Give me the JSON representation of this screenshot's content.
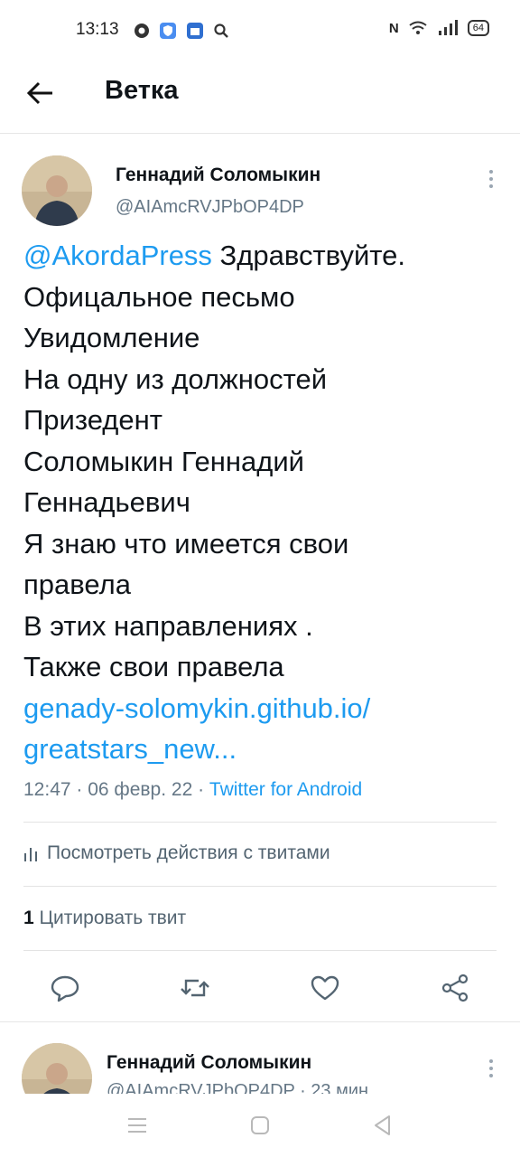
{
  "status_bar": {
    "time": "13:13",
    "battery": "64"
  },
  "header": {
    "title": "Ветка"
  },
  "tweet": {
    "author_name": "Геннадий Соломыкин",
    "author_handle": "@AIAmcRVJPbOP4DP",
    "mention": "@AkordaPress",
    "text_first": " Здравствуйте.",
    "text_lines": "Офицальное песьмо\nУвидомление\nНа одну из должностей\nПризедент\nСоломыкин Геннадий\nГеннадьевич\nЯ знаю что имеется свои\nправела\nВ этих направлениях .\nТакже свои правела",
    "link_line1": "genady-solomykin.github.io/",
    "link_line2": "greatstars_new...",
    "time": "12:47",
    "date": "06 февр. 22",
    "client": "Twitter for Android",
    "dot": " · ",
    "activity_label": "Посмотреть действия с твитами",
    "quote_count": "1",
    "quote_label": " Цитировать твит"
  },
  "reply": {
    "author_name": "Геннадий Соломыкин",
    "handle_time": "@AIAmcRVJPbOP4DP · 23 мин"
  },
  "colors": {
    "accent": "#1d9bf0",
    "secondary": "#657786"
  },
  "icons": [
    "back-arrow-icon",
    "more-icon",
    "reply-icon",
    "retweet-icon",
    "like-icon",
    "share-icon",
    "stats-icon",
    "nav-menu-icon",
    "nav-home-icon",
    "nav-back-icon"
  ]
}
